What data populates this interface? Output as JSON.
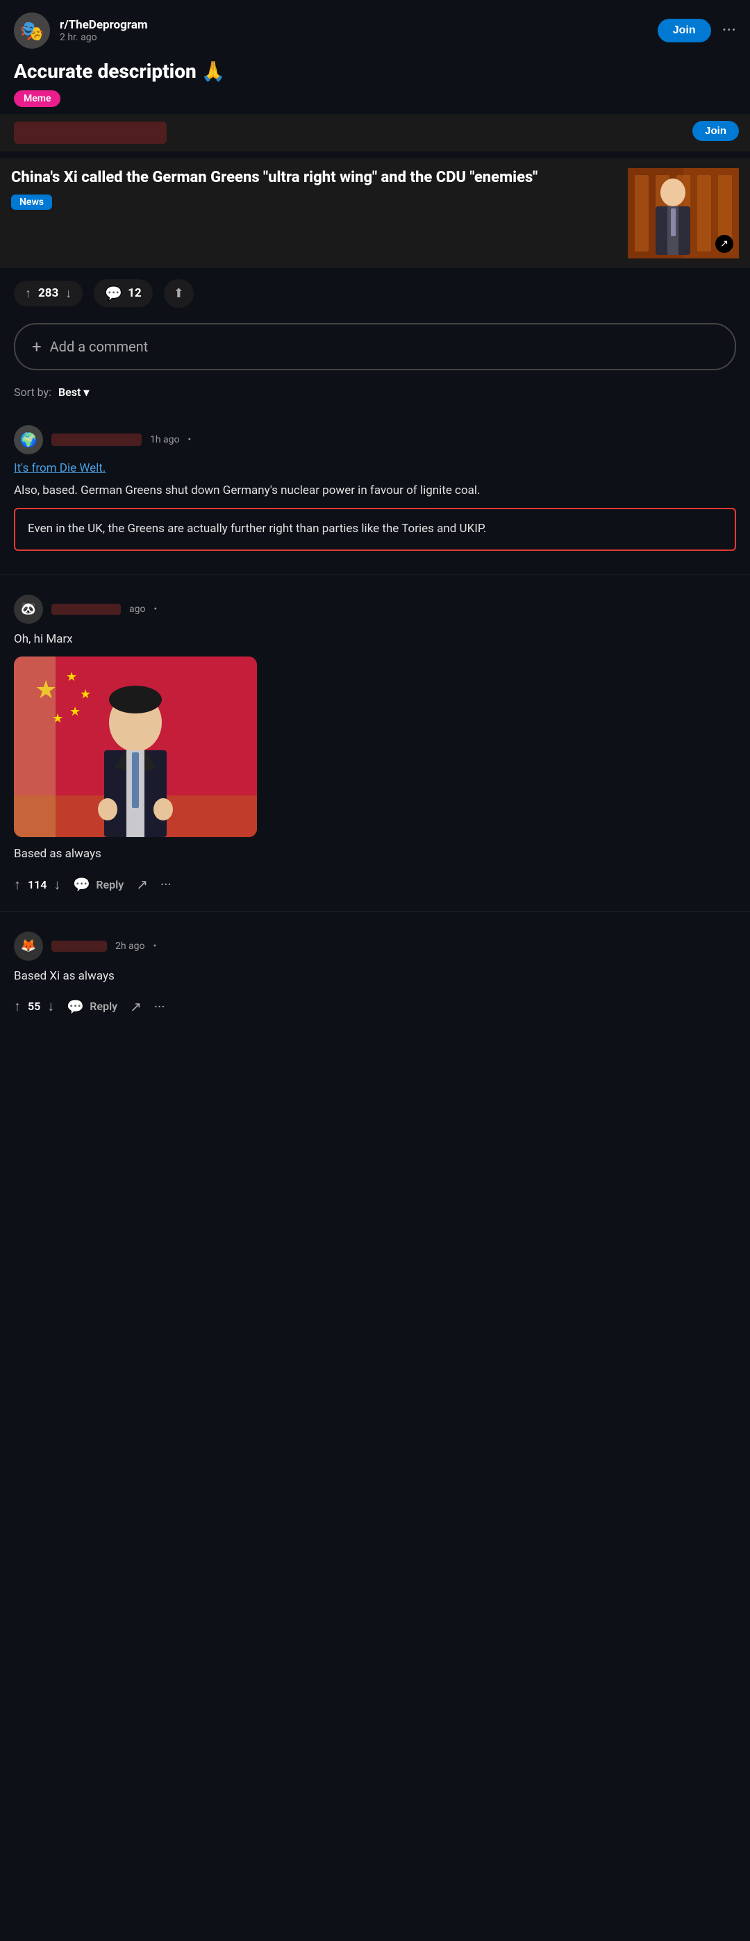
{
  "header": {
    "subreddit": "r/TheDeprogram",
    "time_ago": "2 hr. ago",
    "join_label": "Join",
    "more_options": "···"
  },
  "post": {
    "title": "Accurate description 🙏",
    "flair": "Meme",
    "news_card_join": "Join",
    "news_headline": "China's Xi called the German Greens \"ultra right wing\" and the CDU \"enemies\"",
    "news_flair": "News",
    "external_icon": "↗",
    "vote_count": "283",
    "comment_count": "12",
    "share_icon": "↑"
  },
  "comment_bar": {
    "add_comment": "Add a comment",
    "plus": "+"
  },
  "sort": {
    "label": "Sort by:",
    "value": "Best",
    "chevron": "▾"
  },
  "comments": [
    {
      "avatar_emoji": "🌍",
      "username_blurred": true,
      "time": "1h ago",
      "dot": "•",
      "link_text": "It's from Die Welt.",
      "body_text": "Also, based. German Greens shut down Germany's nuclear power in favour of lignite coal.",
      "highlighted": "Even in the UK, the Greens are actually further right than parties like the Tories and UKIP.",
      "has_image": false,
      "image_caption": "",
      "vote_count": null,
      "reply_label": null
    },
    {
      "avatar_emoji": "🐼",
      "username_blurred": true,
      "time": "ago",
      "dot": "•",
      "link_text": "",
      "body_text": "Oh, hi Marx",
      "highlighted": "",
      "has_image": true,
      "image_caption": "Based as always",
      "vote_count": "114",
      "reply_label": "Reply"
    },
    {
      "avatar_emoji": "🦊",
      "username_blurred": true,
      "time": "2h ago",
      "dot": "•",
      "link_text": "",
      "body_text": "Based Xi as always",
      "highlighted": "",
      "has_image": false,
      "image_caption": "",
      "vote_count": "55",
      "reply_label": "Reply"
    }
  ],
  "icons": {
    "upvote": "↑",
    "downvote": "↓",
    "comment": "💬",
    "share": "↗",
    "more": "···"
  }
}
